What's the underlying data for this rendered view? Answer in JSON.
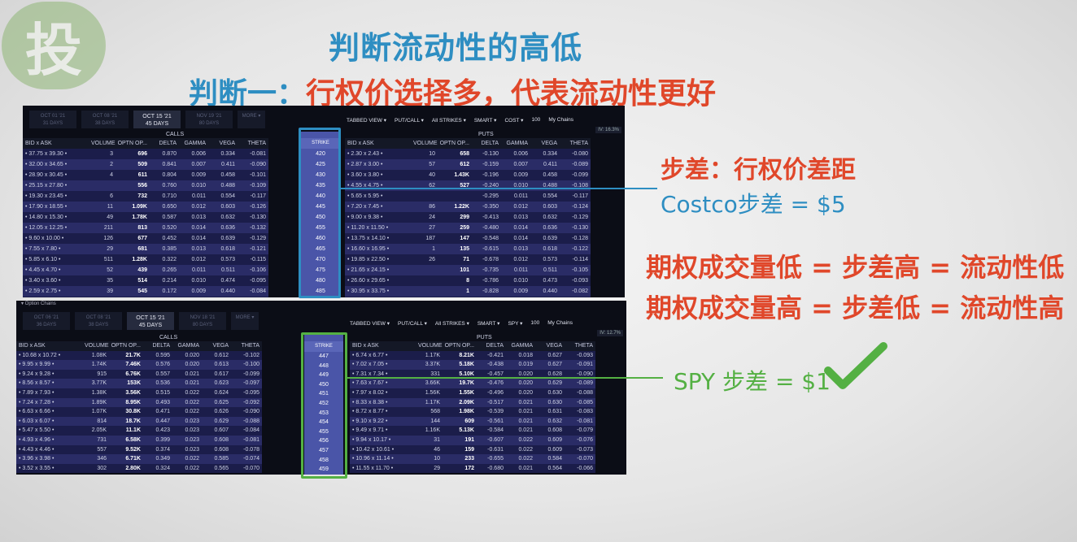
{
  "logo": {
    "glyph": "投",
    "color": "#8fb676"
  },
  "title_main": "判断流动性的高低",
  "title_sub_prefix": "判断一：",
  "title_sub_rest": "行权价选择多，代表流动性更好",
  "annotations": {
    "step_def": "步差：行权价差距",
    "costco_step": "Costco步差 = $5",
    "low_volume": "期权成交量低 = 步差高 = 流动性低",
    "high_volume": "期权成交量高 = 步差低 = 流动性高",
    "spy_step": "SPY 步差 = $1"
  },
  "colors": {
    "red": "#e0472a",
    "blue": "#2e8ec2",
    "green": "#54b043"
  },
  "chain1": {
    "expiries": [
      {
        "date": "OCT 01 '21",
        "days": "31 DAYS"
      },
      {
        "date": "OCT 08 '21",
        "days": "38 DAYS"
      },
      {
        "date": "OCT 15 '21",
        "days": "45 DAYS",
        "active": true
      },
      {
        "date": "NOV 19 '21",
        "days": "80 DAYS"
      }
    ],
    "more": "MORE ▾",
    "toolbar": [
      "TABBED VIEW ▾",
      "PUT/CALL ▾",
      "All STRIKES ▾",
      "SMART ▾",
      "COST ▾",
      "100",
      "My Chains"
    ],
    "iv": "IV: 16.3%",
    "calls_label": "CALLS",
    "puts_label": "PUTS",
    "strike_label": "STRIKE",
    "call_headers": [
      "BID x ASK",
      "VOLUME",
      "OPTN OP...",
      "DELTA",
      "GAMMA",
      "VEGA",
      "THETA"
    ],
    "put_headers": [
      "BID x ASK",
      "VOLUME",
      "OPTN OP...",
      "DELTA",
      "GAMMA",
      "VEGA",
      "THETA"
    ],
    "strikes": [
      "420",
      "425",
      "430",
      "435",
      "440",
      "445",
      "450",
      "455",
      "460",
      "465",
      "470",
      "475",
      "480",
      "485",
      "490",
      "495"
    ],
    "calls": [
      [
        "• 37.75 x 39.30 •",
        "3",
        "696",
        "0.870",
        "0.006",
        "0.334",
        "-0.081"
      ],
      [
        "• 32.00 x 34.65 •",
        "2",
        "509",
        "0.841",
        "0.007",
        "0.411",
        "-0.090"
      ],
      [
        "• 28.90 x 30.45 •",
        "4",
        "611",
        "0.804",
        "0.009",
        "0.458",
        "-0.101"
      ],
      [
        "• 25.15 x 27.80 •",
        "",
        "556",
        "0.760",
        "0.010",
        "0.488",
        "-0.109"
      ],
      [
        "• 19.30 x 23.45 •",
        "6",
        "732",
        "0.710",
        "0.011",
        "0.554",
        "-0.117"
      ],
      [
        "• 17.90 x 18.55 •",
        "11",
        "1.09K",
        "0.650",
        "0.012",
        "0.603",
        "-0.126"
      ],
      [
        "• 14.80 x 15.30 •",
        "49",
        "1.78K",
        "0.587",
        "0.013",
        "0.632",
        "-0.130"
      ],
      [
        "• 12.05 x 12.25 •",
        "211",
        "813",
        "0.520",
        "0.014",
        "0.636",
        "-0.132"
      ],
      [
        "• 9.60 x 10.00 •",
        "126",
        "677",
        "0.452",
        "0.014",
        "0.639",
        "-0.129"
      ],
      [
        "• 7.55 x 7.80 •",
        "29",
        "681",
        "0.385",
        "0.013",
        "0.618",
        "-0.121"
      ],
      [
        "• 5.85 x 6.10 •",
        "511",
        "1.28K",
        "0.322",
        "0.012",
        "0.573",
        "-0.115"
      ],
      [
        "• 4.45 x 4.70 •",
        "52",
        "439",
        "0.265",
        "0.011",
        "0.511",
        "-0.106"
      ],
      [
        "• 3.40 x 3.60 •",
        "35",
        "514",
        "0.214",
        "0.010",
        "0.474",
        "-0.095"
      ],
      [
        "• 2.59 x 2.75 •",
        "39",
        "545",
        "0.172",
        "0.009",
        "0.440",
        "-0.084"
      ],
      [
        "• 1.95 x 2.09 •",
        "94",
        "489",
        "0.138",
        "0.007",
        "0.362",
        "-0.073"
      ],
      [
        "• 1.44 x 1.63 •",
        "51",
        "301",
        "0.110",
        "0.006",
        "0.291",
        "-0.063"
      ]
    ],
    "puts": [
      [
        "• 2.30 x 2.43 •",
        "10",
        "658",
        "-0.130",
        "0.006",
        "0.334",
        "-0.080"
      ],
      [
        "• 2.87 x 3.00 •",
        "57",
        "612",
        "-0.159",
        "0.007",
        "0.411",
        "-0.089"
      ],
      [
        "• 3.60 x 3.80 •",
        "40",
        "1.43K",
        "-0.196",
        "0.009",
        "0.458",
        "-0.099"
      ],
      [
        "• 4.55 x 4.75 •",
        "62",
        "527",
        "-0.240",
        "0.010",
        "0.488",
        "-0.108"
      ],
      [
        "• 5.65 x 5.95 •",
        "",
        "",
        "-0.295",
        "0.011",
        "0.554",
        "-0.117"
      ],
      [
        "• 7.20 x 7.45 •",
        "86",
        "1.22K",
        "-0.350",
        "0.012",
        "0.603",
        "-0.124"
      ],
      [
        "• 9.00 x 9.38 •",
        "24",
        "299",
        "-0.413",
        "0.013",
        "0.632",
        "-0.129"
      ],
      [
        "• 11.20 x 11.50 •",
        "27",
        "259",
        "-0.480",
        "0.014",
        "0.636",
        "-0.130"
      ],
      [
        "• 13.75 x 14.10 •",
        "187",
        "147",
        "-0.548",
        "0.014",
        "0.639",
        "-0.128"
      ],
      [
        "• 16.60 x 16.95 •",
        "1",
        "135",
        "-0.615",
        "0.013",
        "0.618",
        "-0.122"
      ],
      [
        "• 19.85 x 22.50 •",
        "26",
        "71",
        "-0.678",
        "0.012",
        "0.573",
        "-0.114"
      ],
      [
        "• 21.65 x 24.15 •",
        "",
        "101",
        "-0.735",
        "0.011",
        "0.511",
        "-0.105"
      ],
      [
        "• 26.60 x 29.65 •",
        "",
        "8",
        "-0.786",
        "0.010",
        "0.473",
        "-0.093"
      ],
      [
        "• 30.95 x 33.75 •",
        "",
        "1",
        "-0.828",
        "0.009",
        "0.440",
        "-0.082"
      ],
      [
        "• 35.25 x 38.10 •",
        "",
        "2",
        "-0.863",
        "0.007",
        "0.362",
        "-0.071"
      ],
      [
        "• 39.80 x 42.75 •",
        "",
        "",
        "-0.891",
        "0.006",
        "0.290",
        "-0.062"
      ]
    ]
  },
  "chain2": {
    "panel_label": "▾ Option Chains",
    "expiries": [
      {
        "date": "OCT 06 '21",
        "days": "36 DAYS"
      },
      {
        "date": "OCT 08 '21",
        "days": "38 DAYS"
      },
      {
        "date": "OCT 15 '21",
        "days": "45 DAYS",
        "active": true
      },
      {
        "date": "NOV 18 '21",
        "days": "80 DAYS"
      }
    ],
    "more": "MORE ▾",
    "toolbar": [
      "TABBED VIEW ▾",
      "PUT/CALL ▾",
      "All STRIKES ▾",
      "SMART ▾",
      "SPY ▾",
      "100",
      "My Chains"
    ],
    "iv": "IV: 12.7%",
    "calls_label": "CALLS",
    "puts_label": "PUTS",
    "strike_label": "STRIKE",
    "call_headers": [
      "BID x ASK",
      "VOLUME",
      "OPTN OP...",
      "DELTA",
      "GAMMA",
      "VEGA",
      "THETA"
    ],
    "put_headers": [
      "BID x ASK",
      "VOLUME",
      "OPTN OP...",
      "DELTA",
      "GAMMA",
      "VEGA",
      "THETA"
    ],
    "strikes": [
      "447",
      "448",
      "449",
      "450",
      "451",
      "452",
      "453",
      "454",
      "455",
      "456",
      "457",
      "458",
      "459"
    ],
    "calls": [
      [
        "• 10.68 x 10.72 •",
        "1.08K",
        "21.7K",
        "0.595",
        "0.020",
        "0.612",
        "-0.102"
      ],
      [
        "• 9.95 x 9.99 •",
        "1.74K",
        "7.46K",
        "0.576",
        "0.020",
        "0.613",
        "-0.100"
      ],
      [
        "• 9.24 x 9.28 •",
        "915",
        "6.76K",
        "0.557",
        "0.021",
        "0.617",
        "-0.099"
      ],
      [
        "• 8.56 x 8.57 •",
        "3.77K",
        "153K",
        "0.536",
        "0.021",
        "0.623",
        "-0.097"
      ],
      [
        "• 7.89 x 7.93 •",
        "1.38K",
        "3.56K",
        "0.515",
        "0.022",
        "0.624",
        "-0.095"
      ],
      [
        "• 7.24 x 7.28 •",
        "1.89K",
        "8.95K",
        "0.493",
        "0.022",
        "0.625",
        "-0.092"
      ],
      [
        "• 6.63 x 6.66 •",
        "1.07K",
        "30.8K",
        "0.471",
        "0.022",
        "0.626",
        "-0.090"
      ],
      [
        "• 6.03 x 6.07 •",
        "814",
        "18.7K",
        "0.447",
        "0.023",
        "0.629",
        "-0.088"
      ],
      [
        "• 5.47 x 5.50 •",
        "2.05K",
        "11.1K",
        "0.423",
        "0.023",
        "0.607",
        "-0.084"
      ],
      [
        "• 4.93 x 4.96 •",
        "731",
        "6.58K",
        "0.399",
        "0.023",
        "0.608",
        "-0.081"
      ],
      [
        "• 4.43 x 4.46 •",
        "557",
        "9.52K",
        "0.374",
        "0.023",
        "0.608",
        "-0.078"
      ],
      [
        "• 3.96 x 3.98 •",
        "346",
        "6.71K",
        "0.349",
        "0.022",
        "0.585",
        "-0.074"
      ],
      [
        "• 3.52 x 3.55 •",
        "302",
        "2.80K",
        "0.324",
        "0.022",
        "0.565",
        "-0.070"
      ]
    ],
    "puts": [
      [
        "• 6.74 x 6.77 •",
        "1.17K",
        "8.21K",
        "-0.421",
        "0.018",
        "0.627",
        "-0.093"
      ],
      [
        "• 7.02 x 7.05 •",
        "3.37K",
        "5.18K",
        "-0.438",
        "0.019",
        "0.627",
        "-0.091"
      ],
      [
        "• 7.31 x 7.34 •",
        "331",
        "5.10K",
        "-0.457",
        "0.020",
        "0.628",
        "-0.090"
      ],
      [
        "• 7.63 x 7.67 •",
        "3.66K",
        "19.7K",
        "-0.476",
        "0.020",
        "0.629",
        "-0.089"
      ],
      [
        "• 7.97 x 8.02 •",
        "1.56K",
        "1.55K",
        "-0.496",
        "0.020",
        "0.630",
        "-0.088"
      ],
      [
        "• 8.33 x 8.38 •",
        "1.17K",
        "2.09K",
        "-0.517",
        "0.021",
        "0.630",
        "-0.085"
      ],
      [
        "• 8.72 x 8.77 •",
        "568",
        "1.98K",
        "-0.539",
        "0.021",
        "0.631",
        "-0.083"
      ],
      [
        "• 9.10 x 9.22 •",
        "144",
        "609",
        "-0.561",
        "0.021",
        "0.632",
        "-0.081"
      ],
      [
        "• 9.49 x 9.71 •",
        "1.16K",
        "5.13K",
        "-0.584",
        "0.021",
        "0.608",
        "-0.079"
      ],
      [
        "• 9.94 x 10.17 •",
        "31",
        "191",
        "-0.607",
        "0.022",
        "0.609",
        "-0.076"
      ],
      [
        "• 10.42 x 10.61 •",
        "46",
        "159",
        "-0.631",
        "0.022",
        "0.609",
        "-0.073"
      ],
      [
        "• 10.96 x 11.14 •",
        "10",
        "233",
        "-0.655",
        "0.022",
        "0.584",
        "-0.070"
      ],
      [
        "• 11.55 x 11.70 •",
        "29",
        "172",
        "-0.680",
        "0.021",
        "0.564",
        "-0.066"
      ]
    ]
  }
}
